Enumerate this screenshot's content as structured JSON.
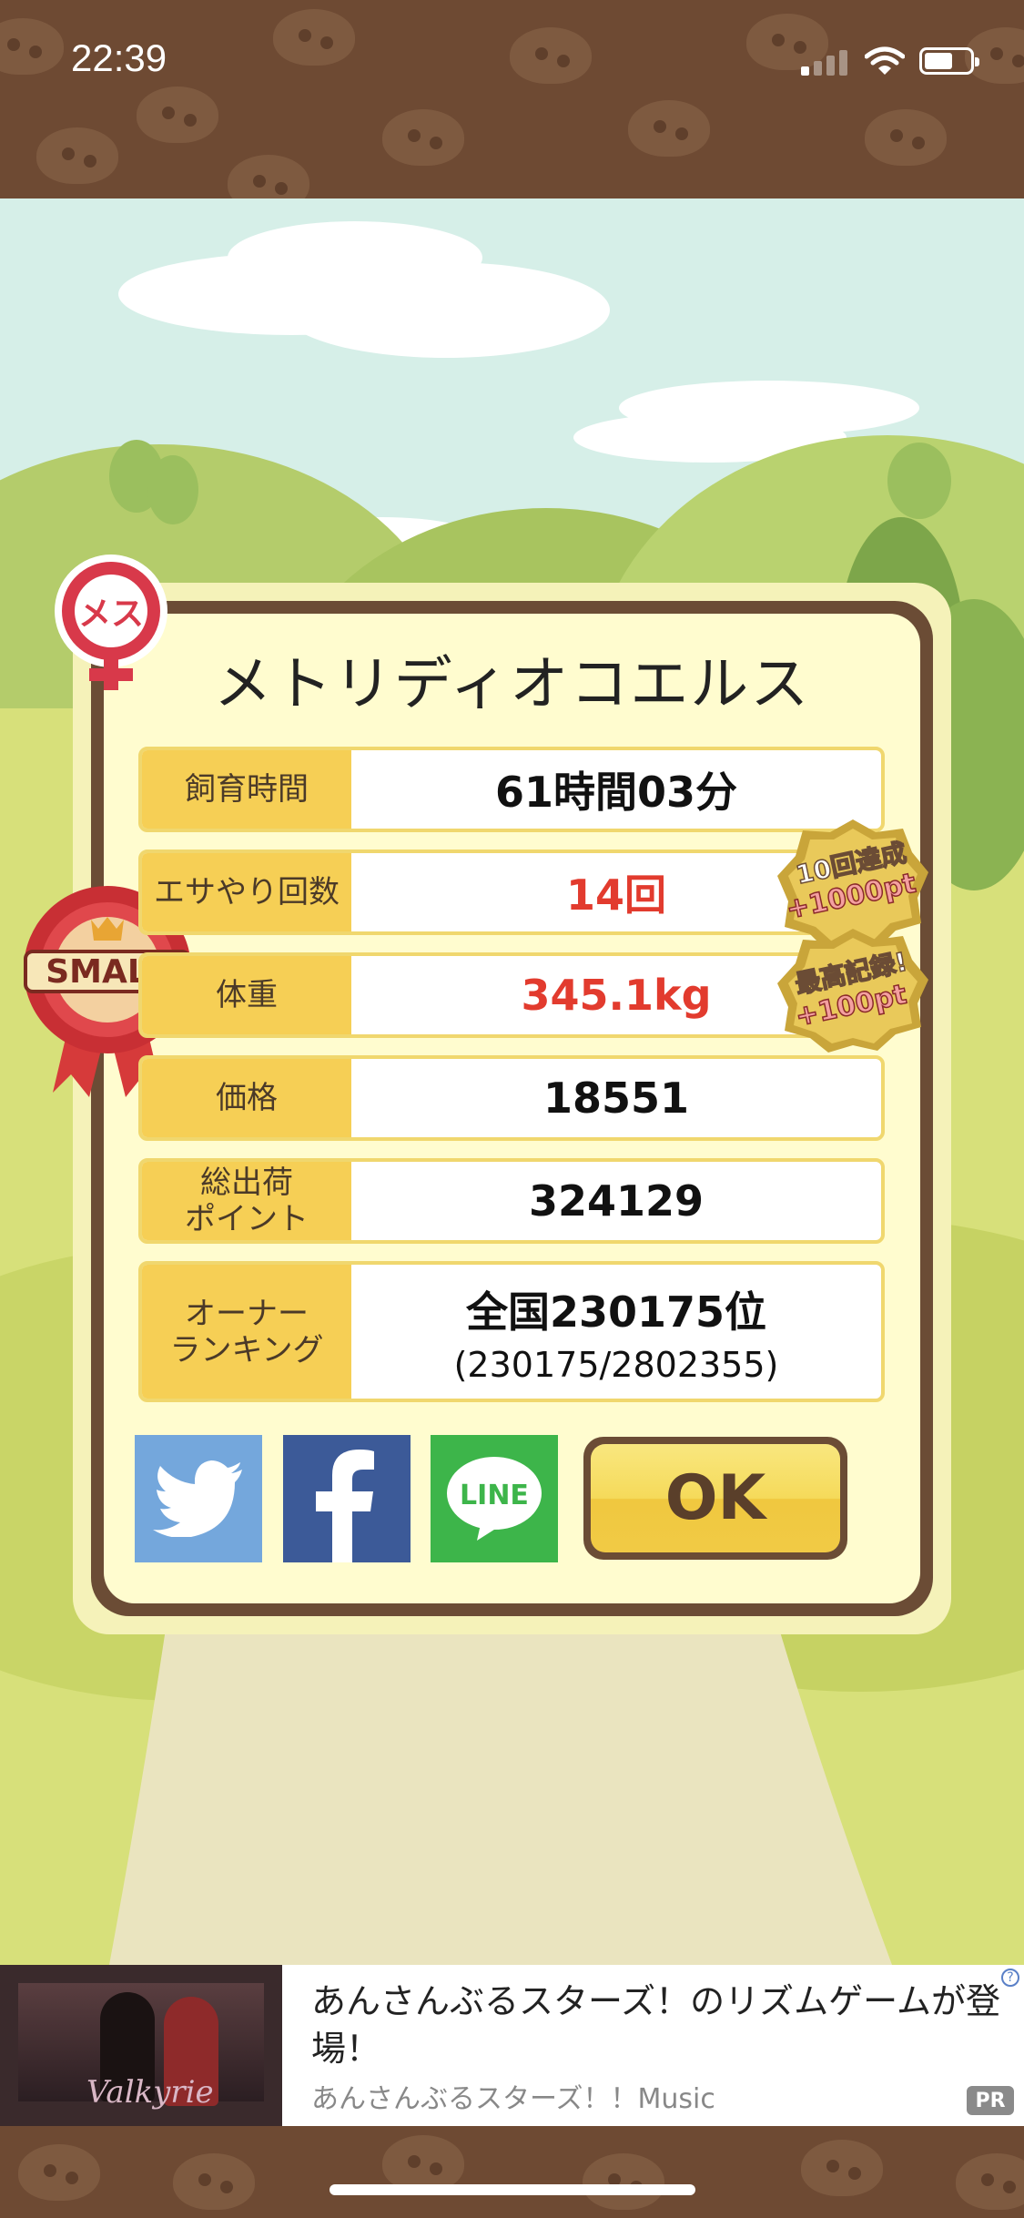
{
  "status_bar": {
    "time": "22:39"
  },
  "popup": {
    "title": "メトリディオコエルス",
    "gender_icon": "female-mesu-icon",
    "gender_text": "メス",
    "size_ribbon_text": "SMALL",
    "rows": [
      {
        "label": "飼育時間",
        "value": "61時間03分",
        "highlight": false
      },
      {
        "label": "エサやり回数",
        "value": "14回",
        "highlight": true
      },
      {
        "label": "体重",
        "value": "345.1kg",
        "highlight": true
      },
      {
        "label": "価格",
        "value": "18551",
        "highlight": false
      },
      {
        "label_line1": "総出荷",
        "label_line2": "ポイント",
        "value": "324129",
        "highlight": false
      },
      {
        "label_line1": "オーナー",
        "label_line2": "ランキング",
        "value_line1": "全国230175位",
        "value_line2": "(230175/2802355)",
        "highlight": false
      }
    ],
    "bonus_badges": [
      {
        "line1": "10回達成",
        "line2": "+1000pt"
      },
      {
        "line1": "最高記録!",
        "line2": "+100pt"
      }
    ],
    "share": {
      "twitter_icon": "twitter-icon",
      "facebook_icon": "facebook-icon",
      "line_label": "LINE"
    },
    "ok_label": "OK"
  },
  "ad": {
    "title": "あんさんぶるスターズ！のリズムゲームが登場！",
    "subtitle": "あんさんぶるスターズ！！Music",
    "image_text": "Valkyrie",
    "pr_label": "PR",
    "info_label": "?"
  },
  "colors": {
    "accent_yellow": "#f6cf55",
    "frame_brown": "#6b4c35",
    "highlight_red": "#e23b2e",
    "panel_cream": "#fffccf"
  }
}
